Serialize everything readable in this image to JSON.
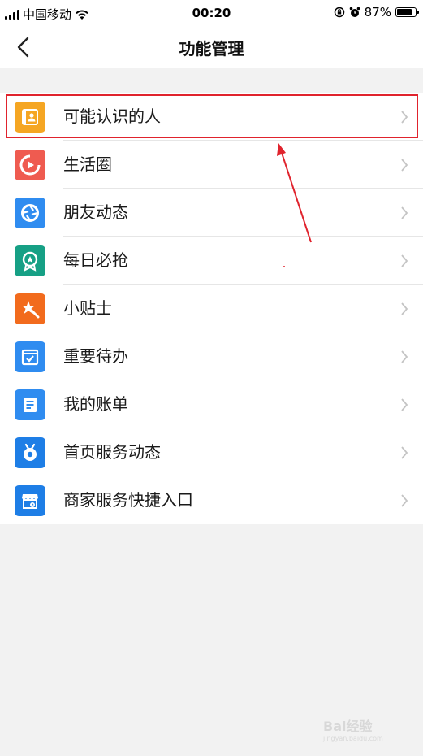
{
  "status_bar": {
    "carrier": "中国移动",
    "time": "00:20",
    "battery": "87%",
    "battery_level": 0.87,
    "icons": [
      "signal-icon",
      "wifi-icon",
      "rotation-lock-icon",
      "alarm-icon",
      "battery-icon"
    ]
  },
  "navbar": {
    "title": "功能管理",
    "back_icon": "chevron-left-icon"
  },
  "items": [
    {
      "label": "可能认识的人",
      "icon": "contact-card-icon",
      "color": "#f5a623"
    },
    {
      "label": "生活圈",
      "icon": "play-circle-icon",
      "color": "#ef5b50"
    },
    {
      "label": "朋友动态",
      "icon": "shutter-icon",
      "color": "#2f8cf0"
    },
    {
      "label": "每日必抢",
      "icon": "badge-star-icon",
      "color": "#16a085"
    },
    {
      "label": "小贴士",
      "icon": "sparkle-icon",
      "color": "#f26b1d"
    },
    {
      "label": "重要待办",
      "icon": "calendar-check-icon",
      "color": "#2f8cf0"
    },
    {
      "label": "我的账单",
      "icon": "document-icon",
      "color": "#2f8cf0"
    },
    {
      "label": "首页服务动态",
      "icon": "tv-icon",
      "color": "#1e7ee6"
    },
    {
      "label": "商家服务快捷入口",
      "icon": "shop-icon",
      "color": "#1e7ee6"
    }
  ],
  "annotation": {
    "highlight_color": "#e0232d"
  },
  "watermark": {
    "text": "Bai经验",
    "subtext": "jingyan.baidu.com"
  }
}
